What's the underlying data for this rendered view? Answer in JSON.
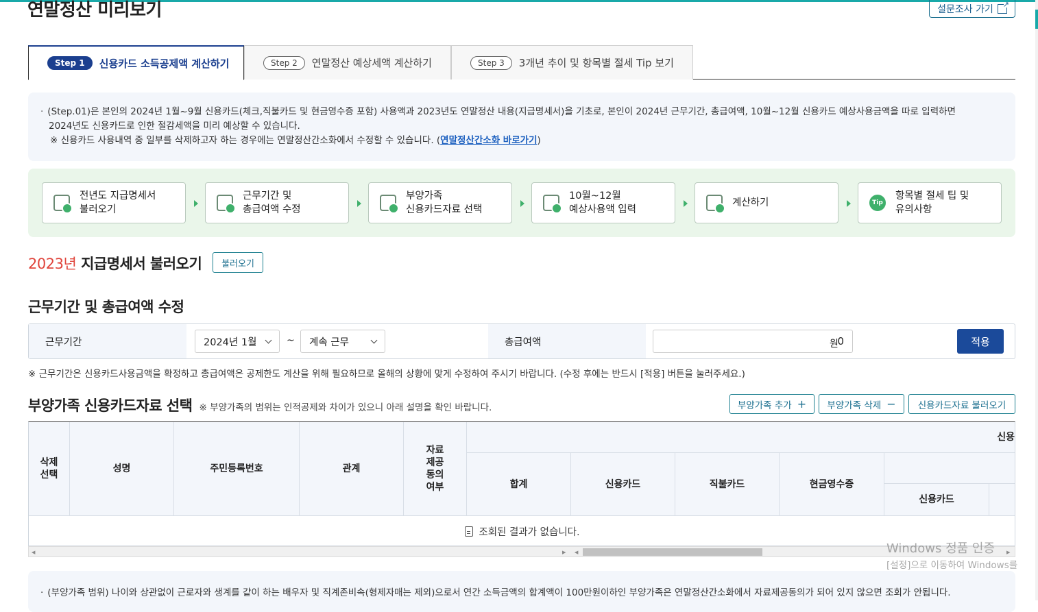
{
  "page_title": "연말정산 미리보기",
  "survey_button": "설문조사 가기",
  "tabs": [
    {
      "step": "Step 1",
      "label": "신용카드 소득공제액 계산하기"
    },
    {
      "step": "Step 2",
      "label": "연말정산 예상세액 계산하기"
    },
    {
      "step": "Step 3",
      "label": "3개년 추이 및 항목별 절세 Tip 보기"
    }
  ],
  "notice": {
    "line1": "(Step.01)은 본인의 2024년 1월~9월 신용카드(체크,직불카드 및 현금영수증 포함) 사용액과 2023년도 연말정산 내용(지급명세서)을 기초로, 본인이 2024년 근무기간, 총급여액, 10월~12월 신용카드 예상사용금액을 따로 입력하면",
    "line2": "2024년도 신용카드로 인한 절감세액을 미리 예상할 수 있습니다.",
    "line3_prefix": "※ 신용카드 사용내역 중 일부를 삭제하고자 하는 경우에는 연말정산간소화에서 수정할 수 있습니다. (",
    "link": "연말정산간소화 바로가기",
    "line3_suffix": ")"
  },
  "step_cards": [
    {
      "line1": "전년도 지급명세서",
      "line2": "불러오기",
      "icon": "document-upload-icon"
    },
    {
      "line1": "근무기간 및",
      "line2": "총급여액 수정",
      "icon": "edit-document-icon"
    },
    {
      "line1": "부양가족",
      "line2": "신용카드자료 선택",
      "icon": "checklist-icon"
    },
    {
      "line1": "10월~12월",
      "line2": "예상사용액 입력",
      "icon": "monitor-input-icon"
    },
    {
      "line1": "계산하기",
      "line2": "",
      "icon": "calculator-icon"
    },
    {
      "line1": "항목별 절세 팁 및",
      "line2": "유의사항",
      "icon": "tip-icon"
    }
  ],
  "section1": {
    "year": "2023년",
    "title": "지급명세서 불러오기",
    "button": "불러오기"
  },
  "section2": {
    "title": "근무기간 및 총급여액 수정",
    "period_label": "근무기간",
    "start_select": "2024년 1월",
    "tilde": "~",
    "end_select": "계속 근무",
    "salary_label": "총급여액",
    "salary_value": "0",
    "unit": "원",
    "apply_button": "적용",
    "note": "※ 근무기간은 신용카드사용금액을 확정하고 총급여액은 공제한도 계산을 위해 필요하므로 올해의 상황에 맞게 수정하여 주시기 바랍니다. (수정 후에는 반드시 [적용] 버튼을 눌러주세요.)"
  },
  "section3": {
    "title": "부양가족 신용카드자료 선택",
    "note": "※ 부양가족의 범위는 인적공제와 차이가 있으니 아래 설명을 확인 바랍니다.",
    "buttons": {
      "add": "부양가족 추가",
      "add_icon": "+",
      "delete": "부양가족 삭제",
      "delete_icon": "−",
      "load": "신용카드자료 불러오기"
    },
    "headers": {
      "delete_select": "삭제 선택",
      "name": "성명",
      "rrn": "주민등록번호",
      "relation": "관계",
      "consent": "자료 제공 동의 여부",
      "group": "신용",
      "total": "합계",
      "credit": "신용카드",
      "debit": "직불카드",
      "cash": "현금영수증",
      "sub_credit": "신용카드"
    },
    "empty_message": "조회된 결과가 없습니다."
  },
  "bottom_notice": "(부양가족 범위) 나이와 상관없이 근로자와 생계를 같이 하는 배우자 및 직계존비속(형제자매는 제외)으로서 연간 소득금액의 합계액이 100만원이하인 부양가족은 연말정산간소화에서 자료제공동의가 되어 있지 않으면 조회가 안됩니다.",
  "watermark": {
    "line1": "Windows 정품 인증",
    "line2": "[설정]으로 이동하여 Windows를"
  },
  "colors": {
    "accent": "#1b4a9a",
    "teal": "#19a9a9",
    "green_bg": "#eaf6ea",
    "red": "#e0453c"
  }
}
